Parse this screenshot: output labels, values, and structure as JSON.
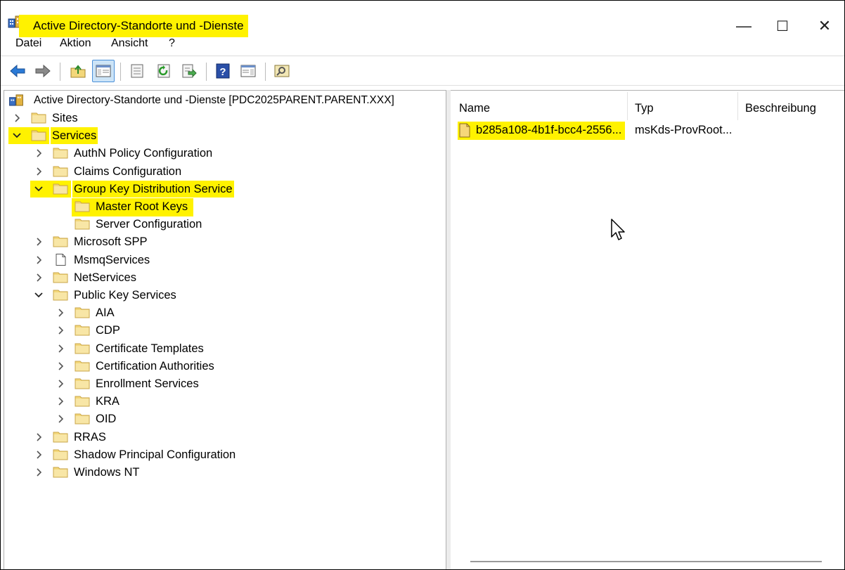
{
  "window": {
    "title": "Active Directory-Standorte und -Dienste",
    "controls": {
      "minimize": "—",
      "maximize": "☐",
      "close": "✕"
    }
  },
  "menu": [
    "Datei",
    "Aktion",
    "Ansicht",
    "?"
  ],
  "toolbar": {
    "buttons": [
      "back-arrow-icon",
      "forward-arrow-icon",
      "up-folder-icon",
      "show-hide-console-tree-icon",
      "properties-icon",
      "refresh-icon",
      "export-list-icon",
      "help-icon",
      "action-pane-icon",
      "find-icon"
    ]
  },
  "tree": {
    "root": "Active Directory-Standorte und -Dienste [PDC2025PARENT.PARENT.XXX]",
    "items": [
      {
        "label": "Sites",
        "expander": "›",
        "highlighted": false
      },
      {
        "label": "Services",
        "expander": "⌄",
        "highlighted": true
      },
      {
        "label": "AuthN Policy Configuration",
        "expander": "›",
        "highlighted": false
      },
      {
        "label": "Claims Configuration",
        "expander": "›",
        "highlighted": false
      },
      {
        "label": "Group Key Distribution Service",
        "expander": "⌄",
        "highlighted": true
      },
      {
        "label": "Master Root Keys",
        "expander": "",
        "highlighted": true
      },
      {
        "label": "Server Configuration",
        "expander": "",
        "highlighted": false
      },
      {
        "label": "Microsoft SPP",
        "expander": "›",
        "highlighted": false
      },
      {
        "label": "MsmqServices",
        "expander": "›",
        "highlighted": false
      },
      {
        "label": "NetServices",
        "expander": "›",
        "highlighted": false
      },
      {
        "label": "Public Key Services",
        "expander": "⌄",
        "highlighted": false
      },
      {
        "label": "AIA",
        "expander": "›",
        "highlighted": false
      },
      {
        "label": "CDP",
        "expander": "›",
        "highlighted": false
      },
      {
        "label": "Certificate Templates",
        "expander": "›",
        "highlighted": false
      },
      {
        "label": "Certification Authorities",
        "expander": "›",
        "highlighted": false
      },
      {
        "label": "Enrollment Services",
        "expander": "›",
        "highlighted": false
      },
      {
        "label": "KRA",
        "expander": "›",
        "highlighted": false
      },
      {
        "label": "OID",
        "expander": "›",
        "highlighted": false
      },
      {
        "label": "RRAS",
        "expander": "›",
        "highlighted": false
      },
      {
        "label": "Shadow Principal Configuration",
        "expander": "›",
        "highlighted": false
      },
      {
        "label": "Windows NT",
        "expander": "›",
        "highlighted": false
      }
    ]
  },
  "list": {
    "columns": [
      "Name",
      "Typ",
      "Beschreibung"
    ],
    "rows": [
      {
        "name": "b285a108-4b1f-bcc4-2556...",
        "type": "msKds-ProvRoot...",
        "description": ""
      }
    ]
  },
  "colors": {
    "highlight": "#fff200",
    "folder": "#f3d77a",
    "folder_edge": "#c9a548",
    "accent": "#2b6cb0"
  }
}
